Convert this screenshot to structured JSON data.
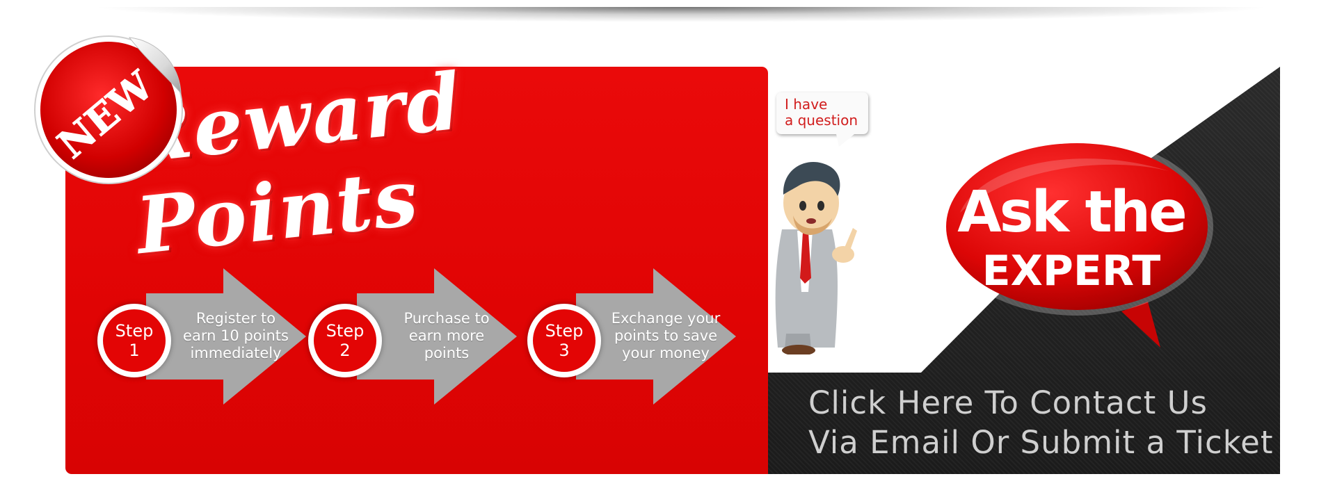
{
  "banner": {
    "new_badge": "NEW",
    "title": "Reward Points",
    "steps": [
      {
        "label": "Step",
        "number": "1",
        "lines": [
          "Register to",
          "earn 10 points",
          "immediately"
        ]
      },
      {
        "label": "Step",
        "number": "2",
        "lines": [
          "Purchase to",
          "earn more",
          "points"
        ]
      },
      {
        "label": "Step",
        "number": "3",
        "lines": [
          "Exchange your",
          "points to save",
          "your money"
        ]
      }
    ]
  },
  "expert": {
    "question": [
      "I have",
      "a question"
    ],
    "title_line1": "Ask the",
    "title_line2": "EXPERT",
    "contact_line1": "Click Here To Contact Us",
    "contact_line2": "Via Email Or Submit a Ticket"
  },
  "colors": {
    "brand_red": "#e30505",
    "arrow_gray": "#a8a8a8",
    "dark_panel": "#222222",
    "contact_text": "#cfcfcf"
  }
}
